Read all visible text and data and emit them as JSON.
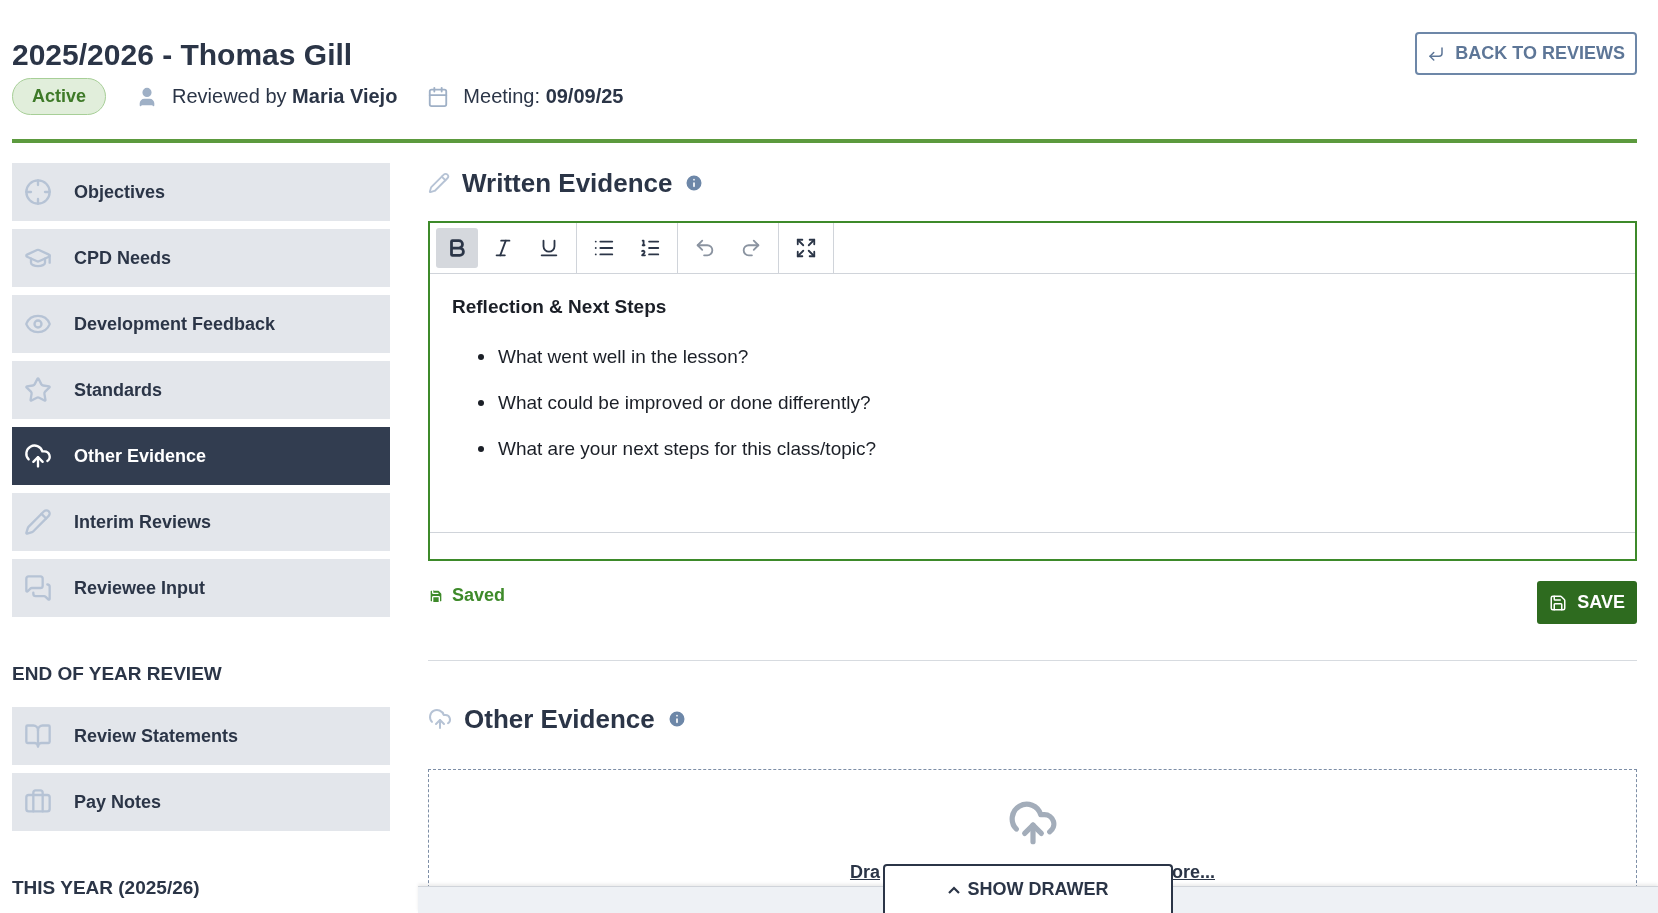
{
  "header": {
    "title": "2025/2026 - Thomas Gill",
    "status": "Active",
    "reviewer": {
      "prefix": "Reviewed by",
      "name": "Maria Viejo"
    },
    "meeting": {
      "prefix": "Meeting:",
      "date": "09/09/25"
    },
    "back_button": "BACK TO REVIEWS"
  },
  "sidebar": {
    "items": [
      {
        "label": "Objectives",
        "selected": false
      },
      {
        "label": "CPD Needs",
        "selected": false
      },
      {
        "label": "Development Feedback",
        "selected": false
      },
      {
        "label": "Standards",
        "selected": false
      },
      {
        "label": "Other Evidence",
        "selected": true
      },
      {
        "label": "Interim Reviews",
        "selected": false
      },
      {
        "label": "Reviewee Input",
        "selected": false
      }
    ],
    "sections": [
      {
        "heading": "END OF YEAR REVIEW",
        "items": [
          {
            "label": "Review Statements",
            "selected": false
          },
          {
            "label": "Pay Notes",
            "selected": false
          }
        ]
      },
      {
        "heading": "THIS YEAR (2025/26)"
      }
    ]
  },
  "written_evidence": {
    "title": "Written Evidence",
    "toolbar": [
      [
        {
          "kind": "bold",
          "active": true
        },
        {
          "kind": "italic",
          "active": false
        },
        {
          "kind": "underline",
          "active": false
        }
      ],
      [
        {
          "kind": "bullets",
          "active": false
        },
        {
          "kind": "numbers",
          "active": false
        }
      ],
      [
        {
          "kind": "undo",
          "active": false
        },
        {
          "kind": "redo",
          "active": false
        }
      ],
      [
        {
          "kind": "fullscreen",
          "active": false
        }
      ]
    ],
    "heading": "Reflection & Next Steps",
    "bullets": [
      "What went well in the lesson?",
      "What could be improved or done differently?",
      "What are your next steps for this class/topic?"
    ],
    "save_status": "Saved",
    "save_button": "SAVE"
  },
  "other_evidence": {
    "title": "Other Evidence",
    "link_start": "Dra",
    "link_end": "ore..."
  },
  "drawer_button": "SHOW DRAWER"
}
